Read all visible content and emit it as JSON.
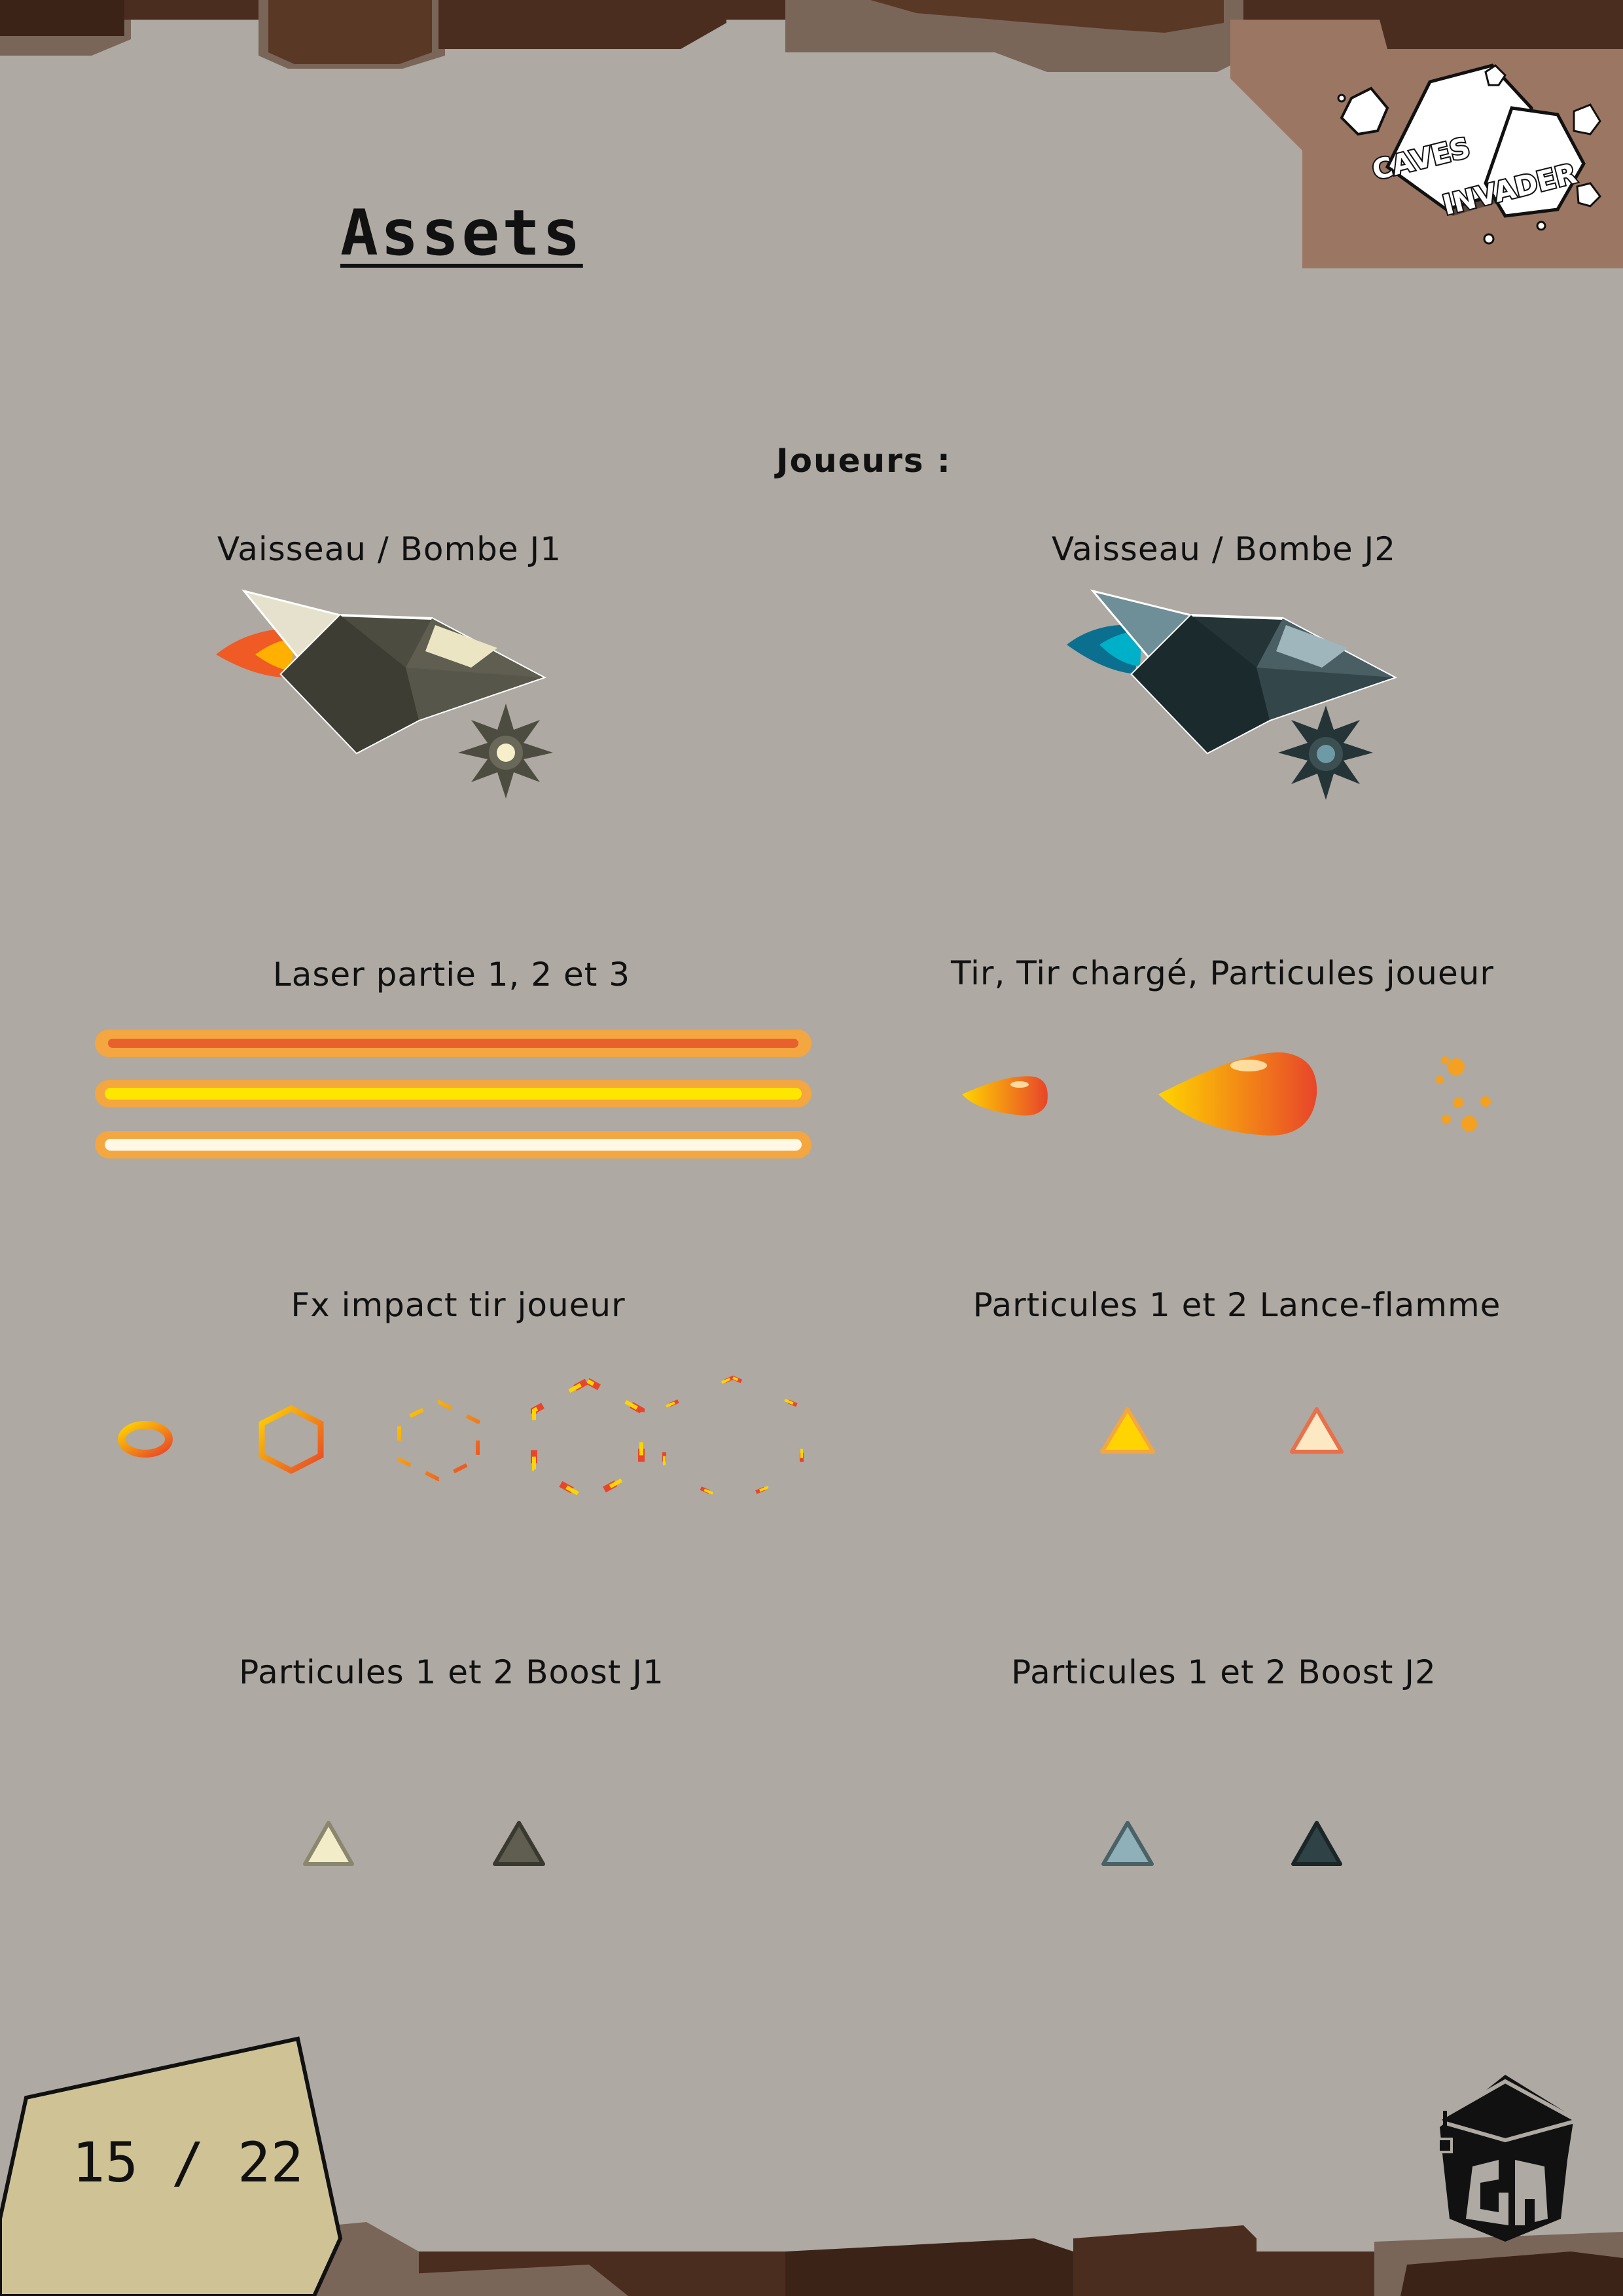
{
  "page": {
    "title": "Assets",
    "section": "Joueurs :",
    "page_number": "15 / 22"
  },
  "logo": {
    "line1": "CAVES",
    "line2": "INVADER"
  },
  "labels": {
    "ship_j1": "Vaisseau / Bombe J1",
    "ship_j2": "Vaisseau / Bombe J2",
    "laser": "Laser partie 1, 2 et 3",
    "shots": "Tir, Tir chargé, Particules joueur",
    "impact": "Fx impact tir joueur",
    "flame": "Particules 1 et 2 Lance-flamme",
    "boost_j1": "Particules 1 et 2 Boost J1",
    "boost_j2": "Particules 1 et 2 Boost J2"
  },
  "colors": {
    "background": "#aea9a2",
    "frame_dark": "#4a2d1f",
    "frame_light": "#7a6659",
    "corner_panel": "#9b7662",
    "page_tag": "#cfc395",
    "ship_j1_body": "#4d4c40",
    "ship_j1_accent": "#ece5c4",
    "ship_j1_flame": "#f47b20",
    "ship_j2_body": "#243437",
    "ship_j2_accent": "#6e8f97",
    "ship_j2_flame": "#00a8c6",
    "fire_yellow": "#ffd400",
    "fire_red": "#e8452a"
  }
}
